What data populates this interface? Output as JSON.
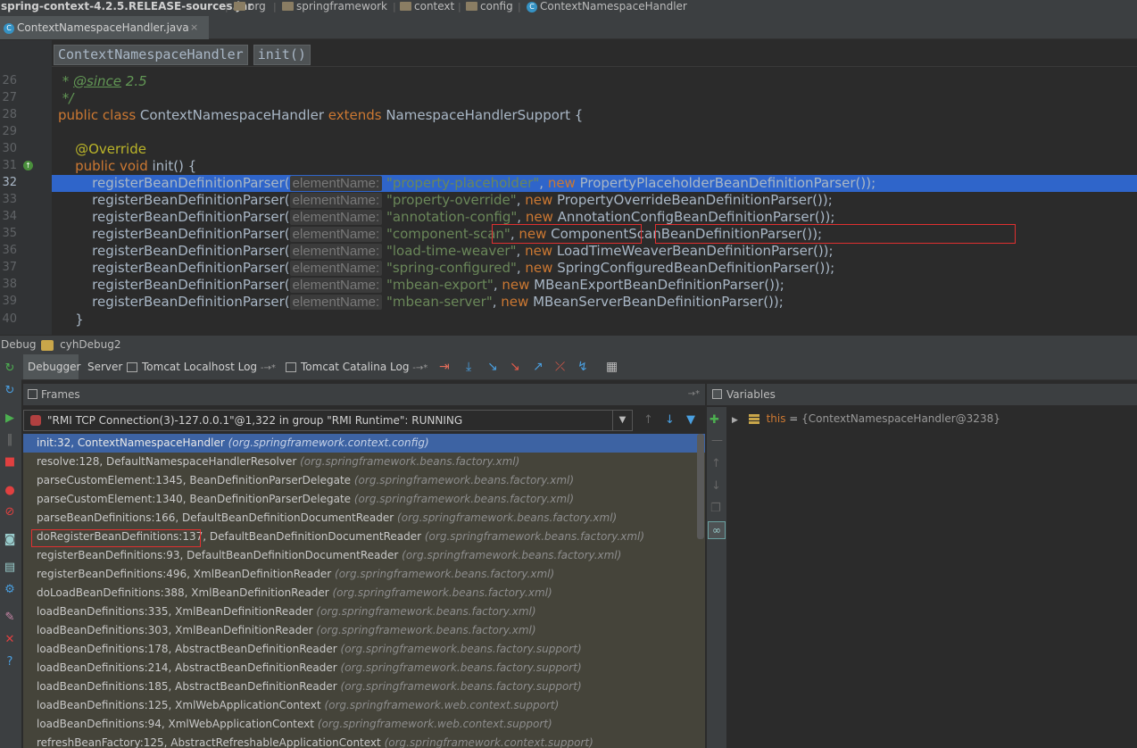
{
  "breadcrumb": {
    "jar": "spring-context-4.2.5.RELEASE-sources.jar",
    "p1": "org",
    "p2": "springframework",
    "p3": "context",
    "p4": "config",
    "cls": "ContextNamespaceHandler"
  },
  "tab": {
    "label": "ContextNamespaceHandler.java",
    "close": "×"
  },
  "editor_crumb": {
    "cls": "ContextNamespaceHandler",
    "method": "init()"
  },
  "code": {
    "l26_star": " * ",
    "l26_tag": "@since",
    "l26_rest": " 2.5",
    "l27": " */",
    "l28_kw": "public class",
    "l28_name": " ContextNamespaceHandler ",
    "l28_ext": "extends",
    "l28_rest": " NamespaceHandlerSupport {",
    "l30": "    @Override",
    "l31_kw": "    public void",
    "l31_rest": " init() {",
    "call": "        registerBeanDefinitionParser(",
    "hint": "elementName:",
    "new": "new",
    "l40": "    }",
    "rows": [
      {
        "n": "32",
        "str": "\"property-placeholder\"",
        "cls": " PropertyPlaceholderBeanDefinitionParser());"
      },
      {
        "n": "33",
        "str": "\"property-override\"",
        "cls": " PropertyOverrideBeanDefinitionParser());"
      },
      {
        "n": "34",
        "str": "\"annotation-config\"",
        "cls": " AnnotationConfigBeanDefinitionParser());"
      },
      {
        "n": "35",
        "str": "\"component-scan\"",
        "cls": " ComponentScanBeanDefinitionParser());"
      },
      {
        "n": "36",
        "str": "\"load-time-weaver\"",
        "cls": " LoadTimeWeaverBeanDefinitionParser());"
      },
      {
        "n": "37",
        "str": "\"spring-configured\"",
        "cls": " SpringConfiguredBeanDefinitionParser());"
      },
      {
        "n": "38",
        "str": "\"mbean-export\"",
        "cls": " MBeanExportBeanDefinitionParser());"
      },
      {
        "n": "39",
        "str": "\"mbean-server\"",
        "cls": " MBeanServerBeanDefinitionParser());"
      }
    ],
    "line_numbers": [
      "26",
      "27",
      "28",
      "29",
      "30",
      "31",
      "40"
    ]
  },
  "debug": {
    "title": "Debug",
    "config": "cyhDebug2",
    "tabs": [
      "Debugger",
      "Server",
      "Tomcat Localhost Log",
      "Tomcat Catalina Log"
    ],
    "tab_suffix": "-→*",
    "frames_label": "Frames",
    "variables_label": "Variables",
    "thread": "\"RMI TCP Connection(3)-127.0.0.1\"@1,322 in group \"RMI Runtime\": RUNNING",
    "var_name": "this",
    "var_eq": " = ",
    "var_value": "{ContextNamespaceHandler@3238}",
    "frames": [
      {
        "m": "init:32, ContextNamespaceHandler",
        "p": "(org.springframework.context.config)"
      },
      {
        "m": "resolve:128, DefaultNamespaceHandlerResolver",
        "p": "(org.springframework.beans.factory.xml)"
      },
      {
        "m": "parseCustomElement:1345, BeanDefinitionParserDelegate",
        "p": "(org.springframework.beans.factory.xml)"
      },
      {
        "m": "parseCustomElement:1340, BeanDefinitionParserDelegate",
        "p": "(org.springframework.beans.factory.xml)"
      },
      {
        "m": "parseBeanDefinitions:166, DefaultBeanDefinitionDocumentReader",
        "p": "(org.springframework.beans.factory.xml)"
      },
      {
        "m": "doRegisterBeanDefinitions:137, DefaultBeanDefinitionDocumentReader",
        "p": "(org.springframework.beans.factory.xml)"
      },
      {
        "m": "registerBeanDefinitions:93, DefaultBeanDefinitionDocumentReader",
        "p": "(org.springframework.beans.factory.xml)"
      },
      {
        "m": "registerBeanDefinitions:496, XmlBeanDefinitionReader",
        "p": "(org.springframework.beans.factory.xml)"
      },
      {
        "m": "doLoadBeanDefinitions:388, XmlBeanDefinitionReader",
        "p": "(org.springframework.beans.factory.xml)"
      },
      {
        "m": "loadBeanDefinitions:335, XmlBeanDefinitionReader",
        "p": "(org.springframework.beans.factory.xml)"
      },
      {
        "m": "loadBeanDefinitions:303, XmlBeanDefinitionReader",
        "p": "(org.springframework.beans.factory.xml)"
      },
      {
        "m": "loadBeanDefinitions:178, AbstractBeanDefinitionReader",
        "p": "(org.springframework.beans.factory.support)"
      },
      {
        "m": "loadBeanDefinitions:214, AbstractBeanDefinitionReader",
        "p": "(org.springframework.beans.factory.support)"
      },
      {
        "m": "loadBeanDefinitions:185, AbstractBeanDefinitionReader",
        "p": "(org.springframework.beans.factory.support)"
      },
      {
        "m": "loadBeanDefinitions:125, XmlWebApplicationContext",
        "p": "(org.springframework.web.context.support)"
      },
      {
        "m": "loadBeanDefinitions:94, XmlWebApplicationContext",
        "p": "(org.springframework.web.context.support)"
      },
      {
        "m": "refreshBeanFactory:125, AbstractRefreshableApplicationContext",
        "p": "(org.springframework.context.support)"
      }
    ]
  },
  "colors": {
    "selection": "#2f65ca",
    "highlight_box": "#e03030",
    "keyword": "#cc7832",
    "string": "#6a8759"
  }
}
